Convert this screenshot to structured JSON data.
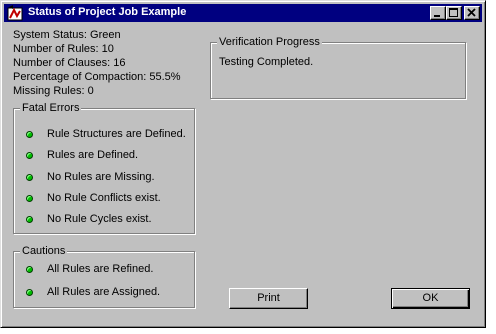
{
  "window": {
    "title": "Status of Project Job Example",
    "controls": {
      "minimize": "minimize-icon",
      "maximize": "maximize-icon",
      "close": "close-icon"
    }
  },
  "summary": {
    "system_status": "System Status: Green",
    "rules": "Number of Rules:  10",
    "clauses": "Number of Clauses:  16",
    "compaction": "Percentage of Compaction:  55.5%",
    "missing_rules": "Missing Rules:   0"
  },
  "fatal_errors": {
    "title": "Fatal Errors",
    "items": [
      {
        "label": "Rule Structures are Defined."
      },
      {
        "label": "Rules are Defined."
      },
      {
        "label": "No Rules are Missing."
      },
      {
        "label": "No Rule Conflicts exist."
      },
      {
        "label": "No Rule Cycles exist."
      }
    ]
  },
  "cautions": {
    "title": "Cautions",
    "items": [
      {
        "label": "All Rules are Refined."
      },
      {
        "label": "All Rules are Assigned."
      }
    ]
  },
  "verification": {
    "title": "Verification Progress",
    "message": "Testing Completed."
  },
  "buttons": {
    "print": "Print",
    "ok": "OK"
  },
  "colors": {
    "titlebar": "#000080",
    "face": "#c0c0c0",
    "indicator": "#00c000"
  }
}
